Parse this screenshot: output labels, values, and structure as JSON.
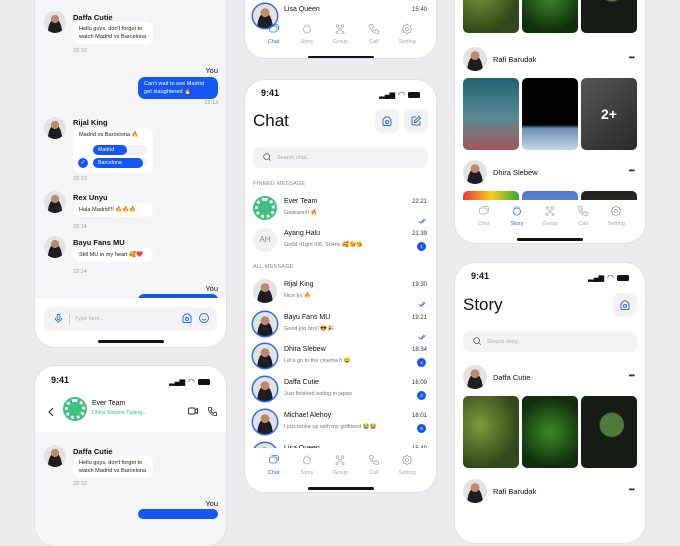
{
  "status_time": "9:41",
  "accent": "#1557f2",
  "tabs": [
    {
      "label": "Chat",
      "icon": "chat-icon"
    },
    {
      "label": "Story",
      "icon": "story-icon"
    },
    {
      "label": "Group",
      "icon": "group-icon"
    },
    {
      "label": "Call",
      "icon": "call-icon"
    },
    {
      "label": "Setting",
      "icon": "gear-icon"
    }
  ],
  "group_chat": {
    "header": {
      "name": "Ever Team",
      "typing": "Dhira Slebew Typing..."
    },
    "you_label": "You",
    "messages": [
      {
        "sender": "Daffa Cutie",
        "text": "Hellu guys, don't forget to watch Madrid vs Barcelona",
        "time": "22:12"
      },
      {
        "sender": "You",
        "text": "Can't wait to see Madrid get slaughtered 🔥",
        "time": "22:13"
      },
      {
        "sender": "Rijal King",
        "poll": {
          "question": "Madrid vs Barcelona 🔥",
          "options": [
            "Madrid",
            "Barcelona"
          ],
          "selected": "Barcelona"
        },
        "time": "22:13"
      },
      {
        "sender": "Rex Unyu",
        "text": "Hala Madrid!!! 🔥🔥🔥",
        "time": "22:14"
      },
      {
        "sender": "Bayu Fans MU",
        "text": "Still MU in my heart 🥰❤️",
        "time": "22:14"
      }
    ],
    "input_placeholder": "Type here..."
  },
  "chat_list": {
    "title": "Chat",
    "search_placeholder": "Search chat...",
    "pinned_label": "PINNED MESSAGE",
    "all_label": "ALL MESSAGE",
    "pinned": [
      {
        "name": "Ever Team",
        "preview": "Gaskann!! 🔥",
        "time": "22:21",
        "status": "read",
        "group": true
      },
      {
        "name": "Ayang Halu",
        "initials": "AH",
        "preview": "Go0d n1ght t00, Su4mi 🥰😘😘",
        "time": "21:39",
        "unread": "1"
      }
    ],
    "all": [
      {
        "name": "Rijal King",
        "preview": "Nice try 🔥",
        "time": "19:30",
        "status": "read"
      },
      {
        "name": "Bayu Fans MU",
        "preview": "Good job bro!! 😎🎉",
        "time": "19:21",
        "status": "read",
        "ring": true
      },
      {
        "name": "Dhira Slebew",
        "preview": "Let's go to the cinema fi 😀",
        "time": "18:34",
        "unread": "4",
        "ring": true
      },
      {
        "name": "Daffa Cutie",
        "preview": "Just finished eating in japan",
        "time": "16:09",
        "unread": "2",
        "ring": true
      },
      {
        "name": "Michael Alehoy",
        "preview": "I just broke up with my girlfriend 😭😭",
        "time": "16:01",
        "unread": "9",
        "ring": true
      },
      {
        "name": "Lisa Queen",
        "preview": "",
        "time": "15:40",
        "ring": true
      }
    ]
  },
  "story": {
    "title": "Story",
    "search_placeholder": "Search story...",
    "users": [
      {
        "name": "Daffa Cutie"
      },
      {
        "name": "Rafi Barudak",
        "more": "2+"
      },
      {
        "name": "Dhira Slebew"
      }
    ]
  }
}
